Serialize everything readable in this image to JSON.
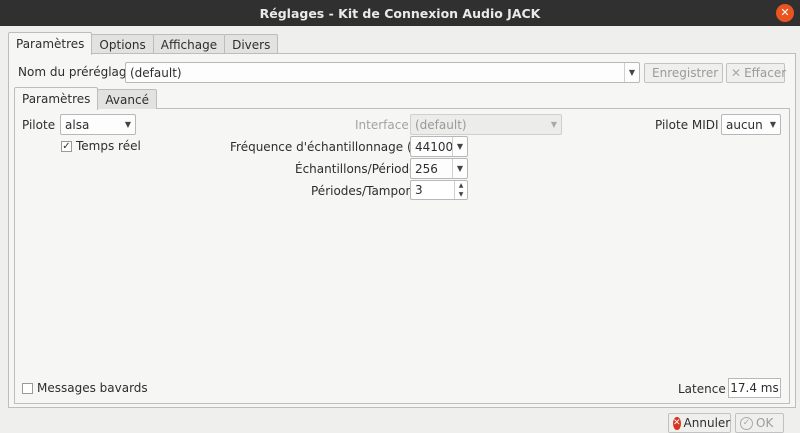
{
  "window": {
    "title": "Réglages - Kit de Connexion Audio JACK",
    "close_glyph": "✕"
  },
  "main_tabs": [
    "Paramètres",
    "Options",
    "Affichage",
    "Divers"
  ],
  "preset": {
    "label": "Nom du préréglage :",
    "value": "(default)",
    "save_label": "Enregistrer",
    "delete_label": "Effacer"
  },
  "inner_tabs": [
    "Paramètres",
    "Avancé"
  ],
  "driver": {
    "label": "Pilote :",
    "value": "alsa"
  },
  "realtime": {
    "label": "Temps réel",
    "checked": true
  },
  "interface": {
    "label": "Interface :",
    "value": "(default)"
  },
  "midi_driver": {
    "label": "Pilote MIDI :",
    "value": "aucun"
  },
  "sample_rate": {
    "label": "Fréquence d'échantillonnage (Hz) :",
    "value": "44100"
  },
  "frames": {
    "label": "Échantillons/Période :",
    "value": "256"
  },
  "periods": {
    "label": "Périodes/Tampon :",
    "value": "3"
  },
  "verbose": {
    "label": "Messages bavards",
    "checked": false
  },
  "latency": {
    "label": "Latence :",
    "value": "17.4 ms"
  },
  "buttons": {
    "cancel": "Annuler",
    "ok": "OK"
  },
  "icons": [
    "close-icon",
    "save-icon",
    "delete-icon",
    "dropdown-arrow-icon",
    "spin-arrows-icon",
    "cancel-icon",
    "ok-icon",
    "check-icon"
  ],
  "colors": {
    "titlebar": "#303030",
    "close": "#e95420",
    "cancel_icon": "#d7341f"
  }
}
